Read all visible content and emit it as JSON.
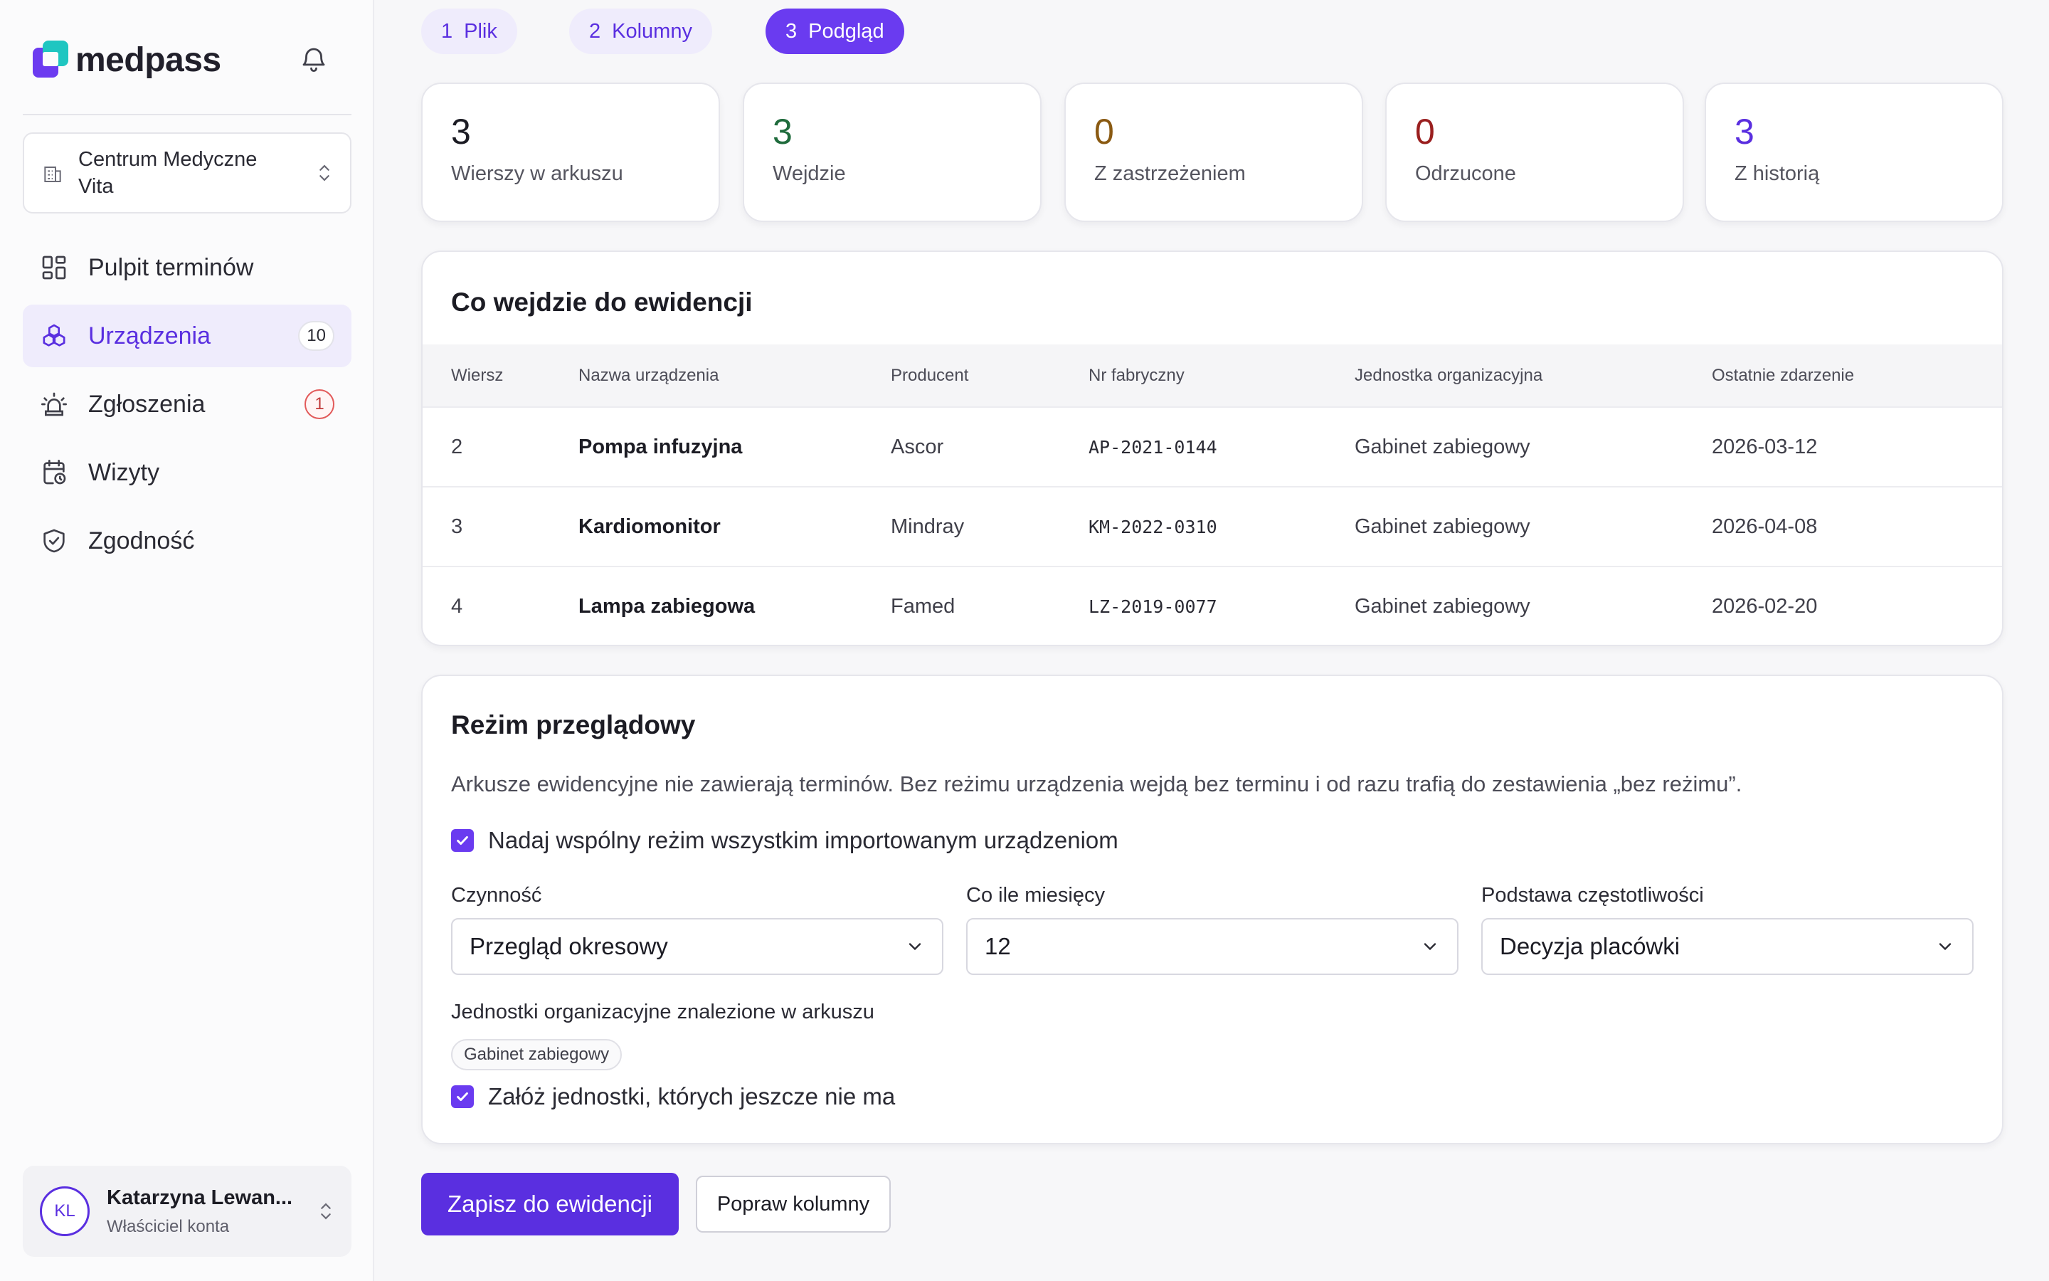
{
  "brand": {
    "name": "medpass"
  },
  "org": {
    "name_line1": "Centrum Medyczne",
    "name_line2": "Vita"
  },
  "nav": [
    {
      "label": "Pulpit terminów",
      "icon": "dashboard-icon"
    },
    {
      "label": "Urządzenia",
      "icon": "devices-icon",
      "badge": "10"
    },
    {
      "label": "Zgłoszenia",
      "icon": "alarm-icon",
      "badge": "1"
    },
    {
      "label": "Wizyty",
      "icon": "calendar-clock-icon"
    },
    {
      "label": "Zgodność",
      "icon": "shield-check-icon"
    }
  ],
  "user": {
    "initials": "KL",
    "name": "Katarzyna Lewan...",
    "role": "Właściciel konta"
  },
  "steps": [
    {
      "num": "1",
      "label": "Plik"
    },
    {
      "num": "2",
      "label": "Kolumny"
    },
    {
      "num": "3",
      "label": "Podgląd"
    }
  ],
  "stats": [
    {
      "value": "3",
      "label": "Wierszy w arkuszu",
      "color": "#1c1c24"
    },
    {
      "value": "3",
      "label": "Wejdzie",
      "color": "#1f6b3c"
    },
    {
      "value": "0",
      "label": "Z zastrzeżeniem",
      "color": "#8a5a12"
    },
    {
      "value": "0",
      "label": "Odrzucone",
      "color": "#9a1f1f"
    },
    {
      "value": "3",
      "label": "Z historią",
      "color": "#5a2fe0"
    }
  ],
  "preview": {
    "title": "Co wejdzie do ewidencji",
    "columns": [
      "Wiersz",
      "Nazwa urządzenia",
      "Producent",
      "Nr fabryczny",
      "Jednostka organizacyjna",
      "Ostatnie zdarzenie"
    ],
    "rows": [
      [
        "2",
        "Pompa infuzyjna",
        "Ascor",
        "AP-2021-0144",
        "Gabinet zabiegowy",
        "2026-03-12"
      ],
      [
        "3",
        "Kardiomonitor",
        "Mindray",
        "KM-2022-0310",
        "Gabinet zabiegowy",
        "2026-04-08"
      ],
      [
        "4",
        "Lampa zabiegowa",
        "Famed",
        "LZ-2019-0077",
        "Gabinet zabiegowy",
        "2026-02-20"
      ]
    ]
  },
  "regime": {
    "title": "Reżim przeglądowy",
    "description": "Arkusze ewidencyjne nie zawierają terminów. Bez reżimu urządzenia wejdą bez terminu i od razu trafią do zestawienia „bez reżimu”.",
    "common_checkbox_label": "Nadaj wspólny reżim wszystkim importowanym urządzeniom",
    "activity_label": "Czynność",
    "activity_value": "Przegląd okresowy",
    "interval_label": "Co ile miesięcy",
    "interval_value": "12",
    "basis_label": "Podstawa częstotliwości",
    "basis_value": "Decyzja placówki",
    "units_label": "Jednostki organizacyjne znalezione w arkuszu",
    "units": [
      "Gabinet zabiegowy"
    ],
    "create_units_label": "Załóż jednostki, których jeszcze nie ma"
  },
  "actions": {
    "save_label": "Zapisz do ewidencji",
    "fix_label": "Popraw kolumny"
  }
}
